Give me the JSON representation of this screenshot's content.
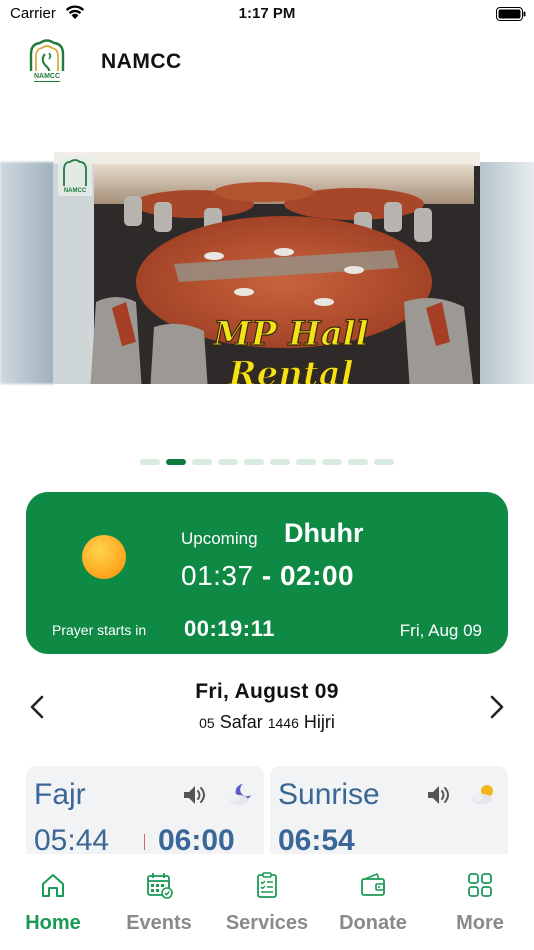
{
  "status_bar": {
    "carrier": "Carrier",
    "time": "1:17 PM"
  },
  "header": {
    "title": "NAMCC"
  },
  "banner": {
    "text_line1": "MP Hall",
    "text_line2": "Rental",
    "slide_count": 10,
    "active_slide": 1
  },
  "prayer_card": {
    "upcoming_label": "Upcoming",
    "upcoming_name": "Dhuhr",
    "start_time": "01:37",
    "range_sep": " - ",
    "end_time": "02:00",
    "starts_in_label": "Prayer starts in",
    "countdown": "00:19:11",
    "date": "Fri, Aug 09",
    "icon": "sun-icon"
  },
  "date_nav": {
    "date": "Fri, August 09",
    "hijri_day": "05",
    "hijri_month": "Safar",
    "hijri_year": "1446",
    "hijri_suffix": "Hijri"
  },
  "prayers": [
    {
      "name": "Fajr",
      "adhan": "05:44",
      "iqama": "06:00",
      "icon": "moon-cloud-icon"
    },
    {
      "name": "Sunrise",
      "time": "06:54",
      "icon": "sun-cloud-icon"
    }
  ],
  "tabs": [
    {
      "label": "Home",
      "icon": "home-icon",
      "active": true
    },
    {
      "label": "Events",
      "icon": "calendar-icon",
      "active": false
    },
    {
      "label": "Services",
      "icon": "clipboard-icon",
      "active": false
    },
    {
      "label": "Donate",
      "icon": "wallet-icon",
      "active": false
    },
    {
      "label": "More",
      "icon": "grid-icon",
      "active": false
    }
  ],
  "colors": {
    "brand_green": "#0e8a45",
    "tab_active": "#1a9a55",
    "tab_inactive": "#8a8a8a",
    "prayer_text": "#3a6797",
    "banner_text": "#f4e21a"
  }
}
